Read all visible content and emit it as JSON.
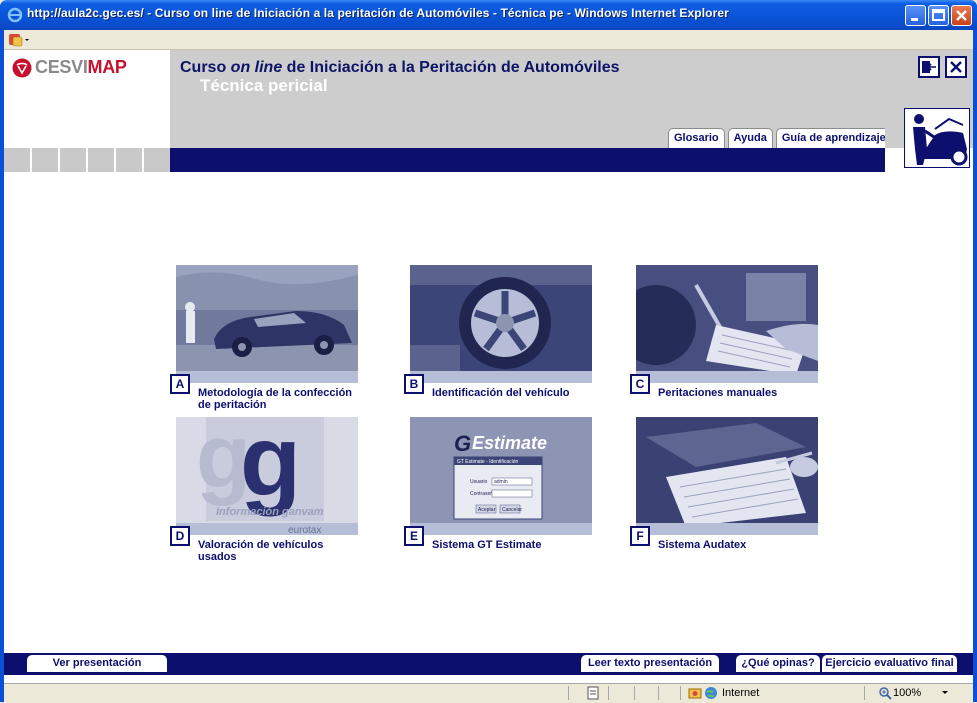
{
  "window": {
    "title": "http://aula2c.gec.es/ - Curso on line de Iniciación a la peritación de Automóviles - Técnica pe - Windows Internet Explorer"
  },
  "brand": {
    "logo_prefix": "CESVI",
    "logo_suffix": "MAP"
  },
  "header": {
    "title_prefix": "Curso ",
    "title_italic": "on line",
    "title_suffix": " de Iniciación a la Peritación de Automóviles",
    "subtitle": "Técnica pericial"
  },
  "top_tabs": [
    "Glosario",
    "Ayuda",
    "Guía de aprendizaje"
  ],
  "modules": [
    {
      "letter": "A",
      "label": "Metodología de la confección de peritación"
    },
    {
      "letter": "B",
      "label": "Identificación del vehículo"
    },
    {
      "letter": "C",
      "label": "Peritaciones manuales"
    },
    {
      "letter": "D",
      "label": "Valoración de vehículos usados"
    },
    {
      "letter": "E",
      "label": "Sistema GT Estimate"
    },
    {
      "letter": "F",
      "label": "Sistema Audatex"
    }
  ],
  "module_images": {
    "d_caption": "Información ganvam",
    "d_brand": "eurotax",
    "e_brand": "Estimate",
    "e_window_title": "GT Estimate - Identificación",
    "e_user_label": "Usuario",
    "e_user_value": "admin",
    "e_pass_label": "Contraseña",
    "e_ok": "Aceptar",
    "e_cancel": "Cancelar"
  },
  "bottom": {
    "ver_presentacion": "Ver presentación",
    "leer_texto": "Leer texto presentación",
    "que_opinas": "¿Qué opinas?",
    "ejercicio": "Ejercicio evaluativo final"
  },
  "status": {
    "zone": "Internet",
    "zoom": "100%"
  },
  "colors": {
    "navy": "#0c0f6e",
    "header_grey": "#cdcdcd",
    "logo_red": "#c8102e"
  }
}
